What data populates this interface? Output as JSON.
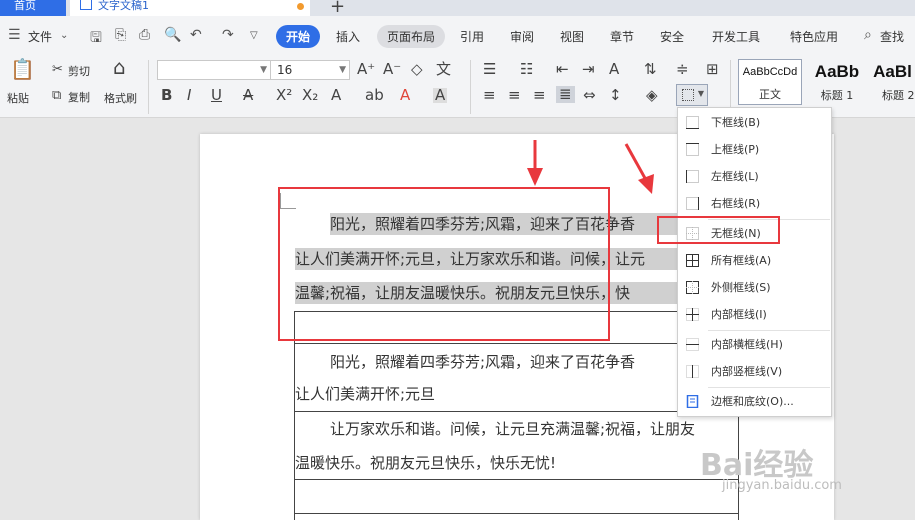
{
  "tabs": {
    "home": "首页",
    "doc": "文字文稿1",
    "new_tab": "+"
  },
  "menu": {
    "file": "文件",
    "start": "开始",
    "insert": "插入",
    "layout": "页面布局",
    "references": "引用",
    "review": "审阅",
    "view": "视图",
    "chapter": "章节",
    "security": "安全",
    "developer": "开发工具",
    "special": "特色应用",
    "search": "查找"
  },
  "ribbon": {
    "paste": "粘贴",
    "cut": "剪切",
    "copy": "复制",
    "format_painter": "格式刷",
    "font_name": "",
    "font_size": "16",
    "bold": "B",
    "italic": "I",
    "underline": "U",
    "styles": [
      {
        "sample": "AaBbCcDd",
        "label": "正文"
      },
      {
        "sample": "AaBb",
        "label": "标题 1"
      },
      {
        "sample": "AaBl",
        "label": "标题 2"
      }
    ]
  },
  "document": {
    "p1_line1": "阳光，照耀着四季芬芳;风霜，迎来了百花争香",
    "p1_line2": "让人们美满开怀;元旦，让万家欢乐和谐。问候，让元",
    "p1_line3": "温馨;祝福，让朋友温暖快乐。祝朋友元旦快乐，快",
    "p2_line1": "阳光，照耀着四季芬芳;风霜，迎来了百花争香",
    "p2_line2": "让人们美满开怀;元旦",
    "p3_line1": "让万家欢乐和谐。问候，让元旦充满温馨;祝福，让朋友",
    "p3_line2": "温暖快乐。祝朋友元旦快乐，快乐无忧!"
  },
  "border_menu": {
    "items": [
      {
        "label": "下框线(B)",
        "icon": "bottom-border-icon"
      },
      {
        "label": "上框线(P)",
        "icon": "top-border-icon"
      },
      {
        "label": "左框线(L)",
        "icon": "left-border-icon"
      },
      {
        "label": "右框线(R)",
        "icon": "right-border-icon"
      },
      {
        "label": "无框线(N)",
        "icon": "no-border-icon"
      },
      {
        "label": "所有框线(A)",
        "icon": "all-borders-icon"
      },
      {
        "label": "外侧框线(S)",
        "icon": "outside-borders-icon"
      },
      {
        "label": "内部框线(I)",
        "icon": "inside-borders-icon"
      },
      {
        "label": "内部横框线(H)",
        "icon": "inside-horizontal-border-icon"
      },
      {
        "label": "内部竖框线(V)",
        "icon": "inside-vertical-border-icon"
      },
      {
        "label": "边框和底纹(O)...",
        "icon": "borders-and-shading-icon"
      }
    ]
  },
  "watermark": {
    "brand": "Bai经验",
    "url": "jingyan.baidu.com"
  },
  "colors": {
    "accent": "#2f6ee6",
    "highlight_box": "#e8383d",
    "selection": "#d0d0d0"
  }
}
